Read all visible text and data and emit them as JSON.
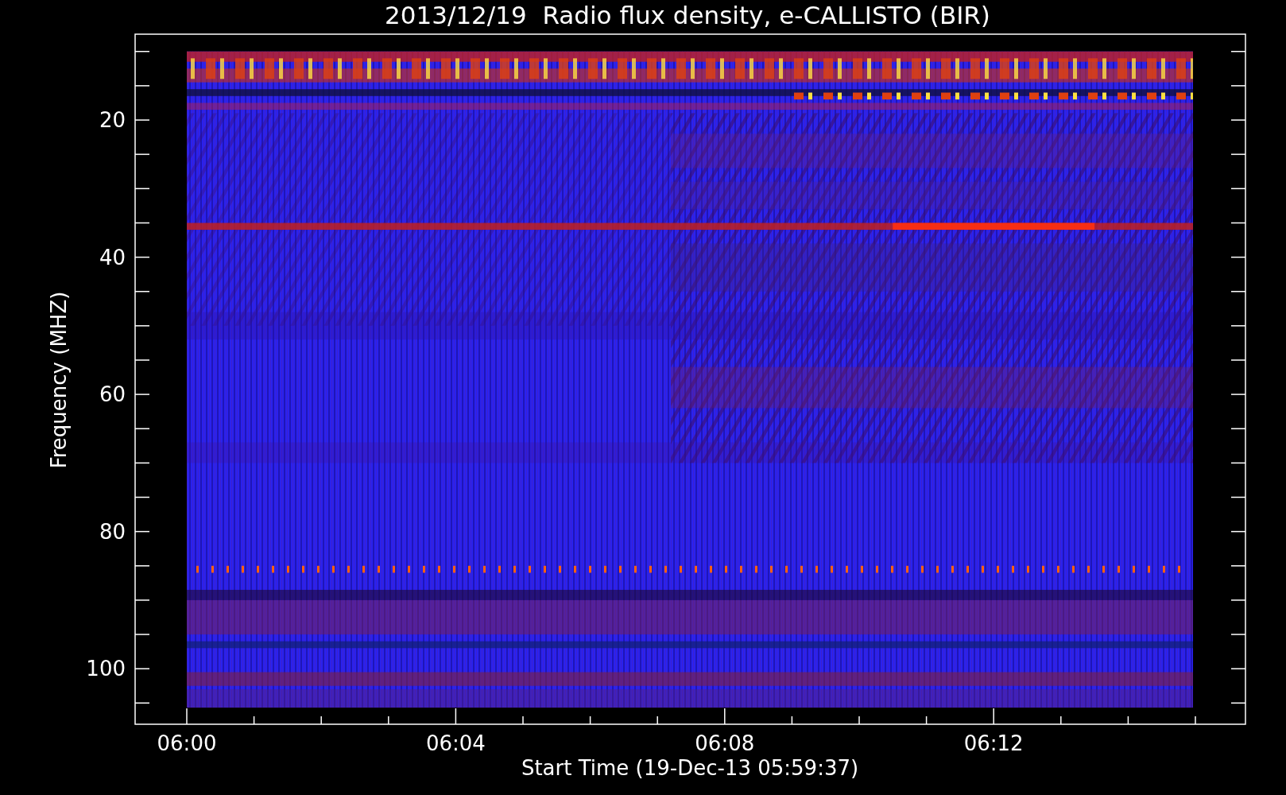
{
  "title": "2013/12/19  Radio flux density, e-CALLISTO (BIR)",
  "y_axis": {
    "label": "Frequency (MHZ)",
    "ticks": [
      "20",
      "40",
      "60",
      "80",
      "100"
    ]
  },
  "x_axis": {
    "label": "Start Time (19-Dec-13 05:59:37)",
    "ticks": [
      "06:00",
      "06:04",
      "06:08",
      "06:12"
    ]
  }
}
